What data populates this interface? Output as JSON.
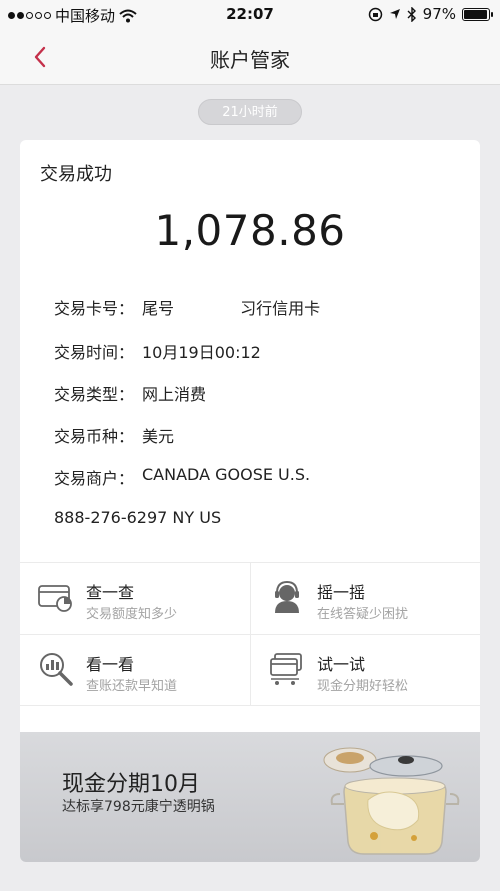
{
  "status_bar": {
    "carrier": "中国移动",
    "time": "22:07",
    "battery": "97%",
    "battery_level": 0.97
  },
  "nav": {
    "title": "账户管家"
  },
  "timestamp_pill": "21小时前",
  "card": {
    "status": "交易成功",
    "amount": "1,078.86",
    "details": [
      {
        "label": "交易卡号：",
        "value": "尾号             习行信用卡"
      },
      {
        "label": "交易时间：",
        "value": "10月19日00:12"
      },
      {
        "label": "交易类型：",
        "value": "网上消费"
      },
      {
        "label": "交易币种：",
        "value": "美元"
      },
      {
        "label": "交易商户：",
        "value": "CANADA GOOSE U.S."
      }
    ],
    "merchant_phone": "888-276-6297 NY US"
  },
  "actions": [
    {
      "title": "查一查",
      "subtitle": "交易额度知多少",
      "icon": "card-pie-icon"
    },
    {
      "title": "摇一摇",
      "subtitle": "在线答疑少困扰",
      "icon": "headset-agent-icon"
    },
    {
      "title": "看一看",
      "subtitle": "查账还款早知道",
      "icon": "magnifier-icon"
    },
    {
      "title": "试一试",
      "subtitle": "现金分期好轻松",
      "icon": "cards-cart-icon"
    }
  ],
  "promo": {
    "title": "现金分期10月",
    "subtitle": "达标享798元康宁透明锅",
    "image": "glass-pot-image"
  },
  "colors": {
    "accent": "#c4304a",
    "background": "#ececee",
    "subtext": "#a3a3a3"
  }
}
